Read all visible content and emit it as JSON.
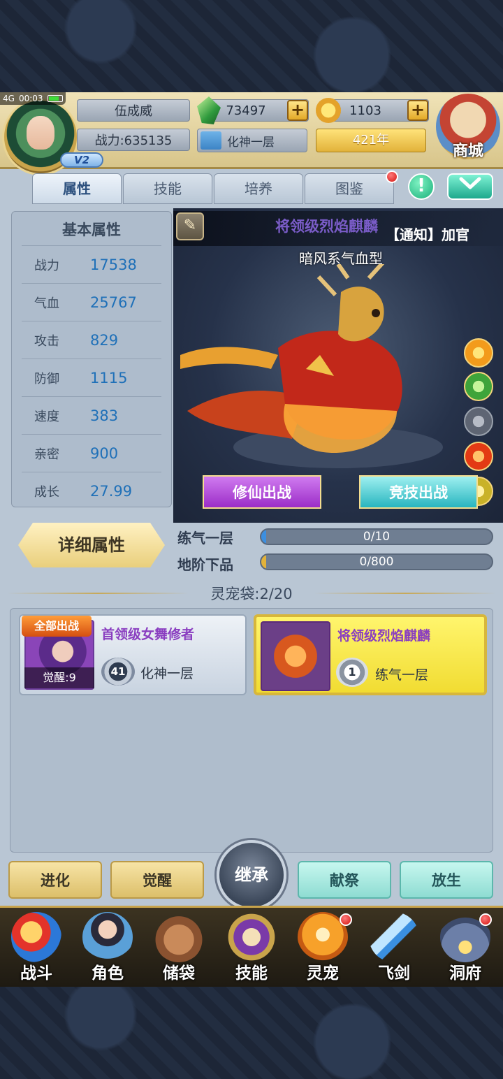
{
  "status": {
    "network": "4G",
    "time": "00:03"
  },
  "player": {
    "name": "伍成威",
    "power_text": "战力:635135",
    "vip": "V2",
    "realm": "化神一层",
    "years": "421年"
  },
  "currency": {
    "jade": "73497",
    "gold": "1103",
    "plus": "+"
  },
  "shop_label": "商城",
  "tabs": [
    {
      "label": "属性",
      "active": true
    },
    {
      "label": "技能",
      "active": false
    },
    {
      "label": "培养",
      "active": false
    },
    {
      "label": "图鉴",
      "active": false,
      "badge": true
    }
  ],
  "buttons": {
    "info": "!",
    "collapse": "⌄"
  },
  "attributes": {
    "title": "基本属性",
    "rows": [
      {
        "label": "战力",
        "value": "17538"
      },
      {
        "label": "气血",
        "value": "25767"
      },
      {
        "label": "攻击",
        "value": "829"
      },
      {
        "label": "防御",
        "value": "1115"
      },
      {
        "label": "速度",
        "value": "383"
      },
      {
        "label": "亲密",
        "value": "900"
      },
      {
        "label": "成长",
        "value": "27.99"
      }
    ],
    "detail_button": "详细属性"
  },
  "pet": {
    "name": "将领级烈焰麒麟",
    "notice": "【通知】加官",
    "type": "暗风系气血型",
    "elements": [
      "sun-icon",
      "leaf-icon",
      "wind-icon",
      "fire-icon",
      "mountain-icon"
    ],
    "battle_xiuxian": "修仙出战",
    "battle_jingji": "竞技出战"
  },
  "progress": [
    {
      "label": "练气一层",
      "text": "0/10",
      "value": 0,
      "max": 10,
      "color": "#3c8fe0"
    },
    {
      "label": "地阶下品",
      "text": "0/800",
      "value": 0,
      "max": 800,
      "color": "#e2b23a"
    }
  ],
  "bag": {
    "label": "灵宠袋:2/20"
  },
  "pet_list": [
    {
      "tag": "全部出战",
      "name": "首领级女舞修者",
      "awake": "觉醒:9",
      "level": "41",
      "realm": "化神一层"
    },
    {
      "name": "将领级烈焰麒麟",
      "level": "1",
      "realm": "练气一层",
      "selected": true
    }
  ],
  "actions": {
    "evolve": "进化",
    "awaken": "觉醒",
    "inherit": "继承",
    "sacrifice": "献祭",
    "release": "放生"
  },
  "nav": [
    {
      "label": "战斗",
      "icon": "battle-icon",
      "badge": false
    },
    {
      "label": "角色",
      "icon": "character-icon",
      "badge": false
    },
    {
      "label": "储袋",
      "icon": "bag-icon",
      "badge": false
    },
    {
      "label": "技能",
      "icon": "skill-icon",
      "badge": false
    },
    {
      "label": "灵宠",
      "icon": "pet-icon",
      "badge": true
    },
    {
      "label": "飞剑",
      "icon": "sword-icon",
      "badge": false
    },
    {
      "label": "洞府",
      "icon": "cave-icon",
      "badge": true
    }
  ],
  "colors": {
    "pet_name": "#7a5cc8",
    "attr_value": "#1f70b8",
    "gold_accent": "#e2b23a"
  }
}
